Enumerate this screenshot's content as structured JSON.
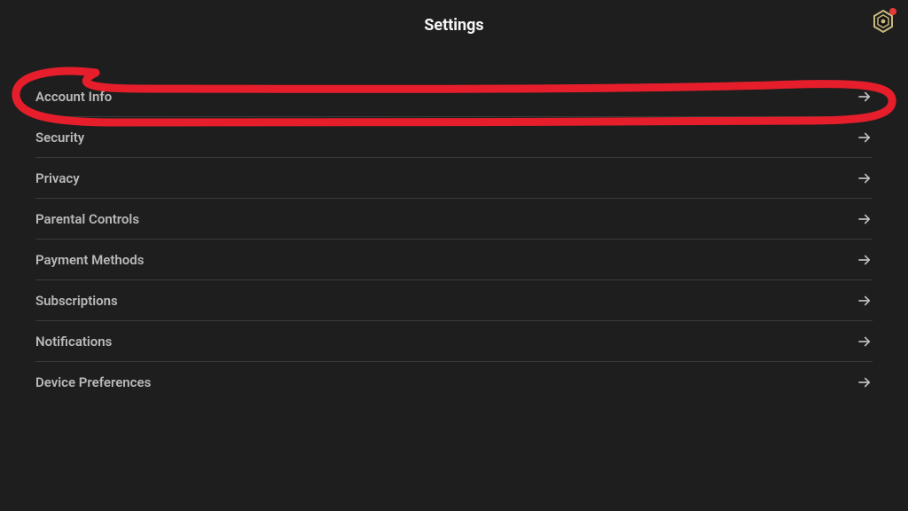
{
  "page_title": "Settings",
  "items": [
    {
      "label": "Account Info"
    },
    {
      "label": "Security"
    },
    {
      "label": "Privacy"
    },
    {
      "label": "Parental Controls"
    },
    {
      "label": "Payment Methods"
    },
    {
      "label": "Subscriptions"
    },
    {
      "label": "Notifications"
    },
    {
      "label": "Device Preferences"
    }
  ],
  "notification_badge": true,
  "annotation": {
    "type": "freehand-circle",
    "color": "#e61e2b",
    "highlighted_item_index": 0
  }
}
